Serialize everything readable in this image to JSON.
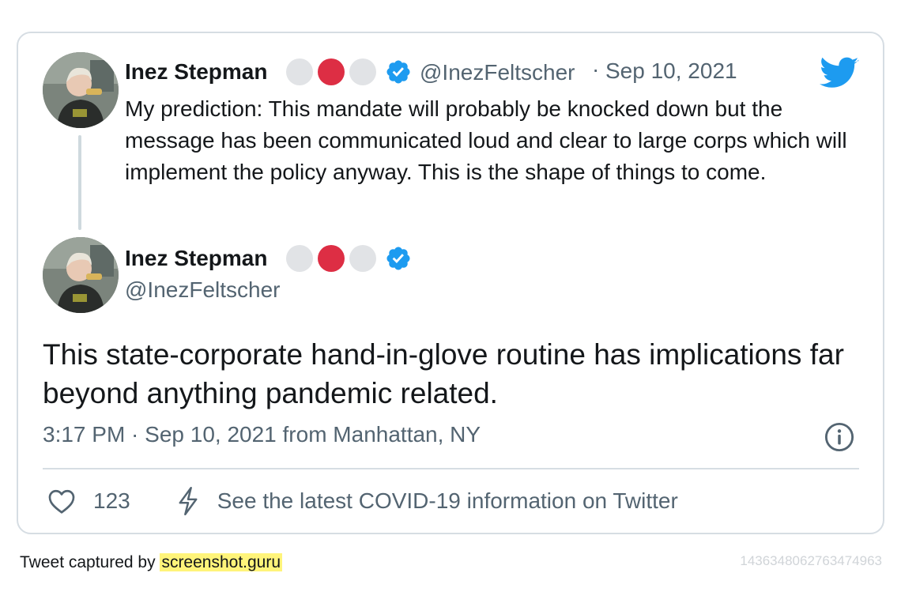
{
  "quoted_tweet": {
    "display_name": "Inez Stepman",
    "handle": "@InezFeltscher",
    "date_separator": "·",
    "date": "Sep 10, 2021",
    "text": "My prediction: This mandate will probably be knocked down but the message has been communicated loud and clear to large corps which will implement the policy anyway. This is the shape of things to come."
  },
  "main_tweet": {
    "display_name": "Inez Stepman",
    "handle": "@InezFeltscher",
    "text": "This state-corporate hand-in-glove routine has implications far beyond anything pandemic related.",
    "meta": "3:17 PM · Sep 10, 2021 from Manhattan, NY",
    "like_count": "123",
    "covid_link": "See the latest COVID-19 information on Twitter"
  },
  "name_emojis": [
    "white-circle",
    "red-circle",
    "white-circle"
  ],
  "footer": {
    "captured_prefix": "Tweet captured by ",
    "captured_site": "screenshot.guru",
    "tweet_id": "1436348062763474963"
  },
  "colors": {
    "twitter_blue": "#1d9bf0",
    "red_circle": "#dd2e44",
    "white_circle": "#e1e3e6",
    "secondary_text": "#536471",
    "border": "#d6dde3",
    "highlight": "#fff47a"
  }
}
